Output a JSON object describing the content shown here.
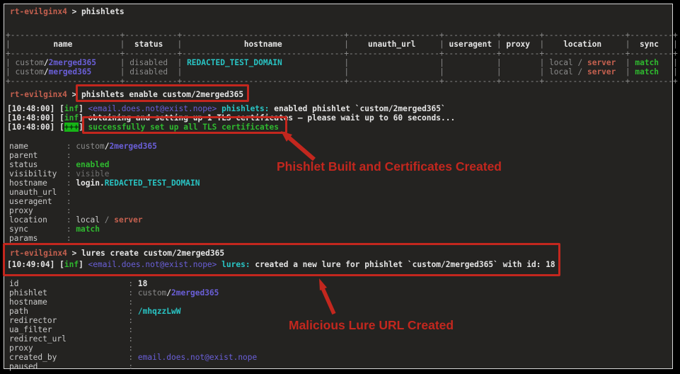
{
  "colors": {
    "terminal_bg": "#242321",
    "annotation_red": "#c3271e",
    "green": "#2fb82f",
    "badge_green_bg": "#17b417",
    "cyan": "#29c4c4",
    "purple": "#6a5fd8",
    "salmon": "#c4604f",
    "dim": "#8a8a8a",
    "dim_dark": "#6f6f6f",
    "label_gray": "#c9c9c9",
    "white": "#e4e4e4"
  },
  "prompt": {
    "host": "rt-evilginx4",
    "symbol": ">"
  },
  "commands": {
    "list_phishlets": "phishlets",
    "enable_phishlet": "phishlets enable custom/2merged365",
    "create_lure": "lures create custom/2merged365"
  },
  "phishlets_table": {
    "headers": [
      "name",
      "status",
      "hostname",
      "unauth_url",
      "useragent",
      "proxy",
      "location",
      "sync"
    ],
    "rows": [
      {
        "name_vendor": "custom",
        "name_id": "2merged365",
        "status": "disabled",
        "hostname": "REDACTED_TEST_DOMAIN",
        "unauth_url": "",
        "useragent": "",
        "proxy": "",
        "location_local": "local",
        "location_server": "server",
        "sync": "match"
      },
      {
        "name_vendor": "custom",
        "name_id": "merged365",
        "status": "disabled",
        "hostname": "",
        "unauth_url": "",
        "useragent": "",
        "proxy": "",
        "location_local": "local",
        "location_server": "server",
        "sync": "match"
      }
    ]
  },
  "enable_logs": [
    {
      "time": "10:48:00",
      "level": "inf",
      "sender": "email.does.not@exist.nope",
      "module": "phishlets",
      "message": "enabled phishlet `custom/2merged365`"
    },
    {
      "time": "10:48:00",
      "level": "inf",
      "message": "obtaining and setting up 1 TLS certificates – please wait up to 60 seconds..."
    },
    {
      "time": "10:48:00",
      "level": "+++",
      "message": "successfully set up all TLS certificates",
      "success": true
    }
  ],
  "lure_logs": [
    {
      "time": "10:49:04",
      "level": "inf",
      "sender": "email.does.not@exist.nope",
      "module": "lures",
      "message": "created a new lure for phishlet `custom/2merged365` with id: 18"
    }
  ],
  "phishlet_details": [
    {
      "label": "name",
      "value": [
        {
          "t": "custom",
          "c": "d"
        },
        {
          "t": "/",
          "c": "w"
        },
        {
          "t": "2merged365",
          "c": "p"
        }
      ]
    },
    {
      "label": "parent",
      "value": []
    },
    {
      "label": "status",
      "value": [
        {
          "t": "enabled",
          "c": "g"
        }
      ]
    },
    {
      "label": "visibility",
      "value": [
        {
          "t": "visible",
          "c": "d2"
        }
      ]
    },
    {
      "label": "hostname",
      "value": [
        {
          "t": "login.",
          "c": "w"
        },
        {
          "t": "REDACTED_TEST_DOMAIN",
          "c": "c"
        }
      ]
    },
    {
      "label": "unauth_url",
      "value": []
    },
    {
      "label": "useragent",
      "value": []
    },
    {
      "label": "proxy",
      "value": []
    },
    {
      "label": "location",
      "value": [
        {
          "t": "local",
          "c": "n"
        },
        {
          "t": " / ",
          "c": "d"
        },
        {
          "t": "server",
          "c": "sal"
        }
      ]
    },
    {
      "label": "sync",
      "value": [
        {
          "t": "match",
          "c": "g"
        }
      ]
    },
    {
      "label": "params",
      "value": []
    }
  ],
  "lure_details": [
    {
      "label": "id",
      "value": [
        {
          "t": "18",
          "c": "w"
        }
      ]
    },
    {
      "label": "phishlet",
      "value": [
        {
          "t": "custom",
          "c": "d"
        },
        {
          "t": "/",
          "c": "w"
        },
        {
          "t": "2merged365",
          "c": "p"
        }
      ]
    },
    {
      "label": "hostname",
      "value": []
    },
    {
      "label": "path",
      "value": [
        {
          "t": "/mhqzzLwW",
          "c": "c"
        }
      ]
    },
    {
      "label": "redirector",
      "value": []
    },
    {
      "label": "ua_filter",
      "value": []
    },
    {
      "label": "redirect_url",
      "value": []
    },
    {
      "label": "proxy",
      "value": []
    },
    {
      "label": "created_by",
      "value": [
        {
          "t": "email.does.not@exist.nope",
          "c": "pe"
        }
      ]
    },
    {
      "label": "paused",
      "value": []
    }
  ],
  "annotations": {
    "certificates": "Phishlet Built and Certificates Created",
    "lure": "Malicious Lure URL Created"
  }
}
